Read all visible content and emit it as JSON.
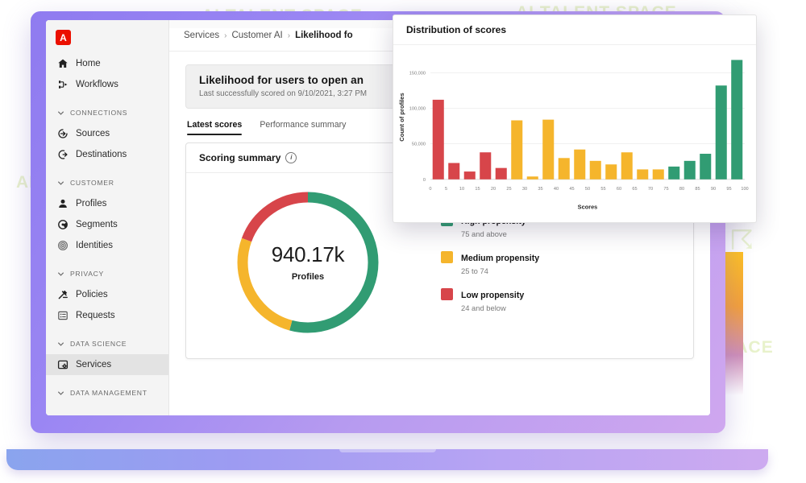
{
  "watermark": {
    "text": "AI TALENT SPACE"
  },
  "app": {
    "brand": {
      "name": "adobe-logo",
      "glyph": "A"
    },
    "sidebar": {
      "items": [
        {
          "type": "item",
          "label": "Home",
          "icon": "home-icon",
          "selected": false
        },
        {
          "type": "item",
          "label": "Workflows",
          "icon": "workflows-icon",
          "selected": false
        },
        {
          "type": "group",
          "label": "Connections",
          "icon": "chevron-down-icon"
        },
        {
          "type": "item",
          "label": "Sources",
          "icon": "sources-icon",
          "selected": false
        },
        {
          "type": "item",
          "label": "Destinations",
          "icon": "destinations-icon",
          "selected": false
        },
        {
          "type": "group",
          "label": "Customer",
          "icon": "chevron-down-icon"
        },
        {
          "type": "item",
          "label": "Profiles",
          "icon": "profile-icon",
          "selected": false
        },
        {
          "type": "item",
          "label": "Segments",
          "icon": "segments-icon",
          "selected": false
        },
        {
          "type": "item",
          "label": "Identities",
          "icon": "identities-icon",
          "selected": false
        },
        {
          "type": "group",
          "label": "Privacy",
          "icon": "chevron-down-icon"
        },
        {
          "type": "item",
          "label": "Policies",
          "icon": "policies-icon",
          "selected": false
        },
        {
          "type": "item",
          "label": "Requests",
          "icon": "requests-icon",
          "selected": false
        },
        {
          "type": "group",
          "label": "Data Science",
          "icon": "chevron-down-icon"
        },
        {
          "type": "item",
          "label": "Services",
          "icon": "services-icon",
          "selected": true
        },
        {
          "type": "group",
          "label": "Data Management",
          "icon": "chevron-down-icon"
        }
      ]
    },
    "breadcrumb": {
      "items": [
        "Services",
        "Customer AI",
        "Likelihood fo"
      ],
      "separator": "›"
    },
    "title_card": {
      "heading": "Likelihood for users to open an",
      "subheading": "Last successfully scored on 9/10/2021, 3:27 PM"
    },
    "tabs": [
      {
        "label": "Latest scores",
        "active": true
      },
      {
        "label": "Performance summary",
        "active": false
      }
    ],
    "scoring_summary": {
      "title": "Scoring summary",
      "info_icon": "info-icon",
      "total_value": "940.17k",
      "total_label": "Profiles",
      "legend": [
        {
          "title": "High propensity",
          "range": "75 and above",
          "color": "#319c73"
        },
        {
          "title": "Medium propensity",
          "range": "25 to 74",
          "color": "#f5b52c"
        },
        {
          "title": "Low propensity",
          "range": "24 and below",
          "color": "#d7454a"
        }
      ]
    }
  },
  "chart_data": {
    "type": "bar",
    "title": "Distribution of scores",
    "xlabel": "Scores",
    "ylabel": "Count of profiles",
    "ylim": [
      0,
      175000
    ],
    "yticks": [
      0,
      50000,
      100000,
      150000
    ],
    "ytick_labels": [
      "0",
      "50,000",
      "100,000",
      "150,000"
    ],
    "xticks": [
      0,
      5,
      10,
      15,
      20,
      25,
      30,
      35,
      40,
      45,
      50,
      55,
      60,
      65,
      70,
      75,
      80,
      85,
      90,
      95,
      100
    ],
    "grid": true,
    "legend_position": "none",
    "categories": [
      0,
      5,
      10,
      15,
      20,
      25,
      30,
      35,
      40,
      45,
      50,
      55,
      60,
      65,
      70,
      75,
      80,
      85,
      90,
      95
    ],
    "values": [
      112000,
      23000,
      11000,
      38000,
      16000,
      83000,
      4000,
      84000,
      30000,
      42000,
      26000,
      21000,
      38000,
      14000,
      14000,
      18000,
      26000,
      36000,
      132000,
      168000
    ],
    "bar_colors": [
      "#d7454a",
      "#d7454a",
      "#d7454a",
      "#d7454a",
      "#d7454a",
      "#f5b52c",
      "#f5b52c",
      "#f5b52c",
      "#f5b52c",
      "#f5b52c",
      "#f5b52c",
      "#f5b52c",
      "#f5b52c",
      "#f5b52c",
      "#f5b52c",
      "#319c73",
      "#319c73",
      "#319c73",
      "#319c73",
      "#319c73"
    ],
    "colors": {
      "low": "#d7454a",
      "medium": "#f5b52c",
      "high": "#319c73"
    }
  },
  "donut_data": {
    "type": "pie",
    "segments": [
      {
        "name": "High propensity",
        "share": 0.542,
        "color": "#319c73"
      },
      {
        "name": "Medium propensity",
        "share": 0.264,
        "color": "#f5b52c"
      },
      {
        "name": "Low propensity",
        "share": 0.194,
        "color": "#d7454a"
      }
    ]
  },
  "theme": {
    "accent_purple": "#9a86f3",
    "sidebar_bg": "#f4f4f4",
    "adobe_red": "#eb1000"
  }
}
